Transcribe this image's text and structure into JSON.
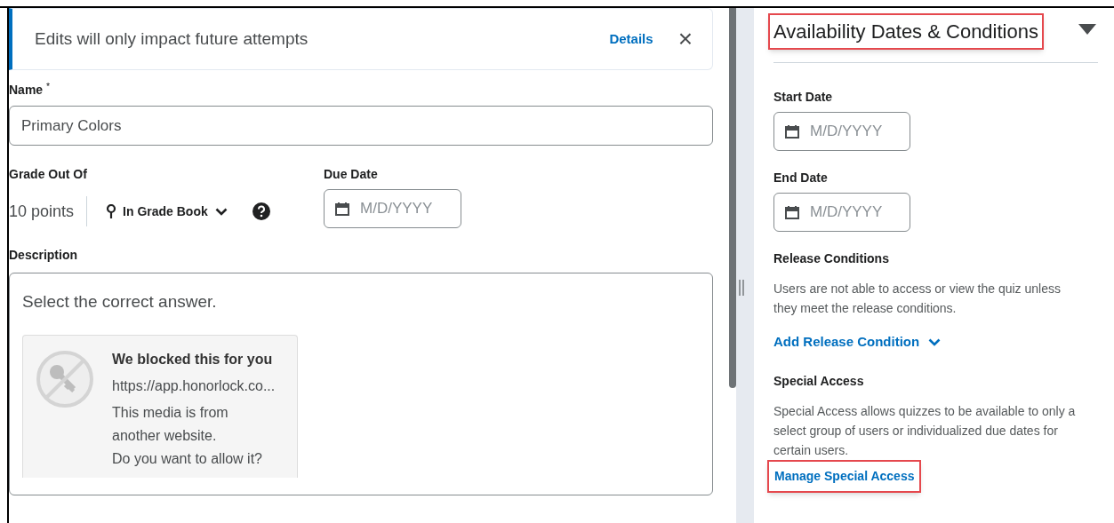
{
  "notice": {
    "text": "Edits will only impact future attempts",
    "link": "Details",
    "close": "×"
  },
  "name_field": {
    "label": "Name",
    "required_mark": "*",
    "value": "Primary Colors"
  },
  "grade": {
    "label": "Grade Out Of",
    "value": "10 points",
    "grade_book": "In Grade Book"
  },
  "due_date": {
    "label": "Due Date",
    "placeholder": "M/D/YYYY"
  },
  "description": {
    "label": "Description",
    "text": "Select the correct answer.",
    "blocked_media": {
      "title": "We blocked this for you",
      "url": "https://app.honorlock.co...",
      "lines": [
        "This media is from",
        "another website.",
        "Do you want to allow it?"
      ]
    }
  },
  "availability": {
    "title": "Availability Dates & Conditions",
    "expanded": true,
    "start_date": {
      "label": "Start Date",
      "placeholder": "M/D/YYYY"
    },
    "end_date": {
      "label": "End Date",
      "placeholder": "M/D/YYYY"
    },
    "release_conditions": {
      "label": "Release Conditions",
      "text": "Users are not able to access or view the quiz unless they meet the release conditions.",
      "link": "Add Release Condition"
    },
    "special_access": {
      "label": "Special Access",
      "text": "Special Access allows quizzes to be available to only a select group of users or individualized due dates for certain users.",
      "link": "Manage Special Access"
    }
  }
}
